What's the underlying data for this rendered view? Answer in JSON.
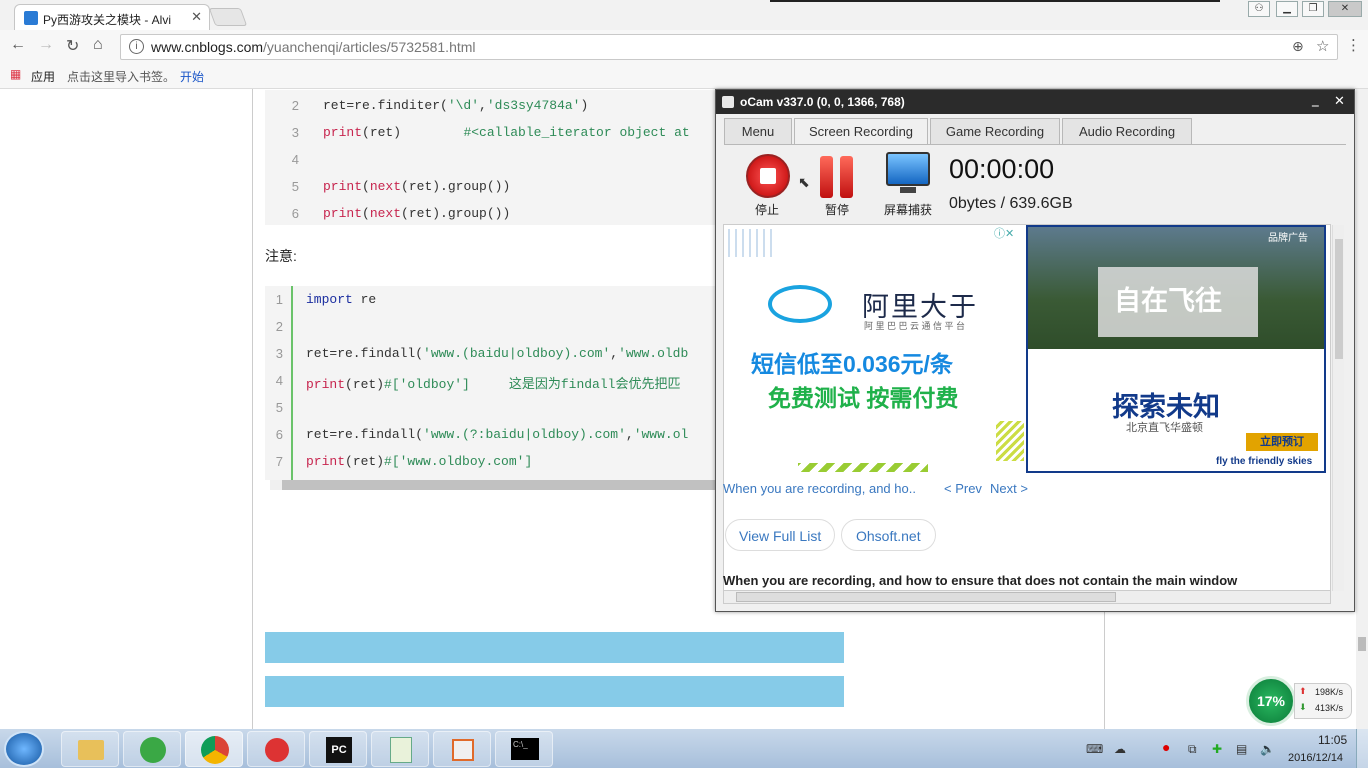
{
  "browser": {
    "tab_title": "Py西游攻关之模块 - Alvi",
    "url_host": "www.cnblogs.com",
    "url_path": "/yuanchenqi/articles/5732581.html",
    "bookmarks": {
      "apps": "应用",
      "import_hint": "点击这里导入书签。",
      "start": "开始"
    }
  },
  "article": {
    "block1": [
      {
        "n": "2",
        "code": "ret=re.finditer('\\d','ds3sy4784a')"
      },
      {
        "n": "3",
        "code": "print(ret)        #<callable_iterator object at"
      },
      {
        "n": "4",
        "code": ""
      },
      {
        "n": "5",
        "code": "print(next(ret).group())"
      },
      {
        "n": "6",
        "code": "print(next(ret).group())"
      }
    ],
    "note": "注意:",
    "block2": [
      {
        "n": "1",
        "code": "import re"
      },
      {
        "n": "2",
        "code": ""
      },
      {
        "n": "3",
        "code": "ret=re.findall('www.(baidu|oldboy).com','www.oldb"
      },
      {
        "n": "4",
        "code": "print(ret)#['oldboy']     这是因为findall会优先把匹"
      },
      {
        "n": "5",
        "code": ""
      },
      {
        "n": "6",
        "code": "ret=re.findall('www.(?:baidu|oldboy).com','www.ol"
      },
      {
        "n": "7",
        "code": "print(ret)#['www.oldboy.com']"
      }
    ]
  },
  "ocam": {
    "title": "oCam v337.0 (0, 0, 1366, 768)",
    "tabs": [
      "Menu",
      "Screen Recording",
      "Game Recording",
      "Audio Recording"
    ],
    "stop_label": "停止",
    "pause_label": "暂停",
    "capture_label": "屏幕捕获",
    "timer": "00:00:00",
    "size": "0bytes / 639.6GB",
    "ad_left": {
      "brand": "阿里大于",
      "brand_sub": "阿 里 巴 巴 云 通 信 平 台",
      "line1": "短信低至0.036元/条",
      "line2": "免费测试 按需付费"
    },
    "ad_right": {
      "headline": "自在飞往",
      "sub": "探索未知",
      "caption": "北京直飞华盛顿",
      "cta": "立即预订",
      "slogan": "fly the friendly skies",
      "badge": "品牌广告"
    },
    "link_text": "When you are recording, and ho..",
    "prev": "< Prev",
    "next": "Next >",
    "btn_full_list": "View Full List",
    "btn_site": "Ohsoft.net",
    "bottom_text": "When you are recording, and how to ensure that does not contain the main window"
  },
  "net": {
    "percent": "17%",
    "up": "198K/s",
    "down": "413K/s"
  },
  "clock": {
    "time": "11:05",
    "date": "2016/12/14"
  },
  "colors": {
    "accent": "#86cbe8",
    "stop": "#d42020",
    "ocam_title": "#2b2b2b"
  }
}
